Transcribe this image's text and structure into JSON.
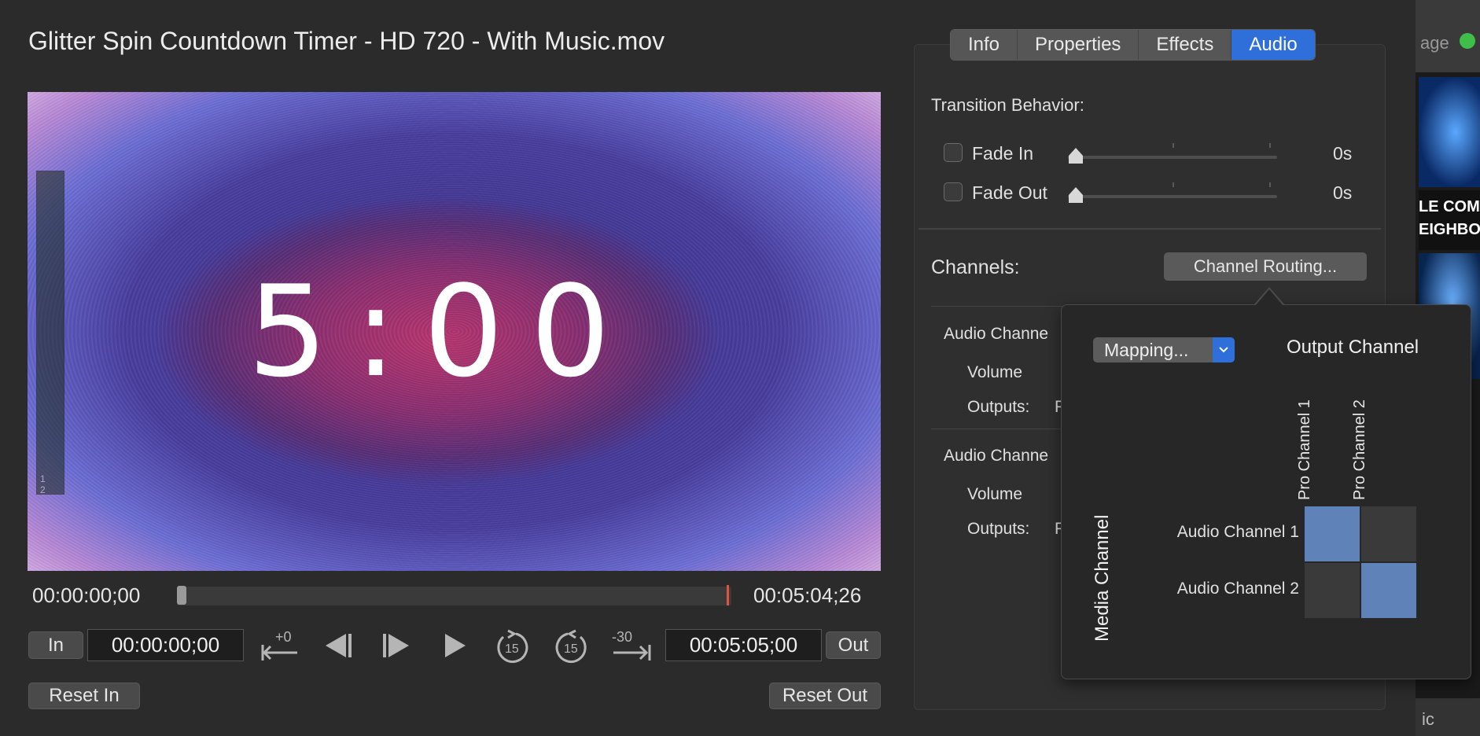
{
  "window": {
    "title": "Glitter Spin Countdown Timer - HD 720 - With Music.mov"
  },
  "preview": {
    "countdown_text": "5:00",
    "meter_labels": "1 2"
  },
  "timeline": {
    "start_time": "00:00:00;00",
    "end_time": "00:05:04;26",
    "playhead_progress": 0.0
  },
  "controls": {
    "in_label": "In",
    "in_time": "00:00:00;00",
    "nudge_back_label": "+0",
    "skip_back_label": "15",
    "skip_forward_label": "15",
    "nudge_forward_label": "-30",
    "out_time": "00:05:05;00",
    "out_label": "Out",
    "reset_in_label": "Reset In",
    "reset_out_label": "Reset Out"
  },
  "tabs": [
    {
      "label": "Info",
      "active": false
    },
    {
      "label": "Properties",
      "active": false
    },
    {
      "label": "Effects",
      "active": false
    },
    {
      "label": "Audio",
      "active": true
    }
  ],
  "audio_panel": {
    "transition_behavior_label": "Transition Behavior:",
    "fade_in": {
      "label": "Fade In",
      "checked": false,
      "value": "0s"
    },
    "fade_out": {
      "label": "Fade Out",
      "checked": false,
      "value": "0s"
    },
    "channels_label": "Channels:",
    "channel_routing_button": "Channel Routing...",
    "channel_sections": [
      {
        "title": "Audio Channe",
        "volume_label": "Volume",
        "outputs_label": "Outputs:",
        "outputs_value": "P"
      },
      {
        "title": "Audio Channe",
        "volume_label": "Volume",
        "outputs_label": "Outputs:",
        "outputs_value": "P"
      }
    ]
  },
  "routing_popover": {
    "mapping_button": "Mapping...",
    "output_channel_label": "Output Channel",
    "media_channel_label": "Media Channel",
    "output_channels": [
      "Pro Channel 1",
      "Pro Channel 2"
    ],
    "media_channels": [
      "Audio Channel 1",
      "Audio Channel 2"
    ],
    "matrix": [
      [
        true,
        false
      ],
      [
        false,
        true
      ]
    ],
    "on_color": "#5f83b8",
    "off_color": "#3a3a3a"
  },
  "right_strip": {
    "top_text": "age",
    "banner_line1": "LE COM",
    "banner_line2": "EIGHBO",
    "bottom_text": "ic",
    "status_color": "#3fbf4a"
  },
  "colors": {
    "accent": "#2e6fd9",
    "out_marker": "#e0533d"
  }
}
